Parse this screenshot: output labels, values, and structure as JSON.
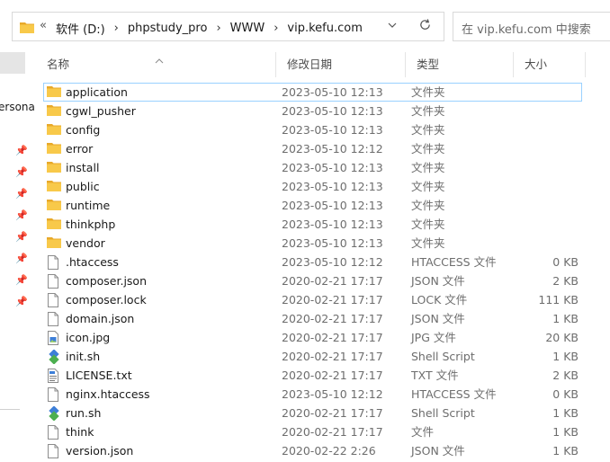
{
  "address": {
    "back_glyph": "«",
    "crumbs": [
      "软件 (D:)",
      "phpstudy_pro",
      "WWW",
      "vip.kefu.com"
    ],
    "separator": "›"
  },
  "search": {
    "placeholder": "在 vip.kefu.com 中搜索"
  },
  "nav": {
    "cut_text": "ersona"
  },
  "columns": {
    "name": "名称",
    "date": "修改日期",
    "type": "类型",
    "size": "大小"
  },
  "files": [
    {
      "name": "application",
      "date": "2023-05-10 12:13",
      "type": "文件夹",
      "size": "",
      "icon": "folder-icon"
    },
    {
      "name": "cgwl_pusher",
      "date": "2023-05-10 12:13",
      "type": "文件夹",
      "size": "",
      "icon": "folder-icon"
    },
    {
      "name": "config",
      "date": "2023-05-10 12:13",
      "type": "文件夹",
      "size": "",
      "icon": "folder-icon"
    },
    {
      "name": "error",
      "date": "2023-05-10 12:12",
      "type": "文件夹",
      "size": "",
      "icon": "folder-icon"
    },
    {
      "name": "install",
      "date": "2023-05-10 12:13",
      "type": "文件夹",
      "size": "",
      "icon": "folder-icon"
    },
    {
      "name": "public",
      "date": "2023-05-10 12:13",
      "type": "文件夹",
      "size": "",
      "icon": "folder-icon"
    },
    {
      "name": "runtime",
      "date": "2023-05-10 12:13",
      "type": "文件夹",
      "size": "",
      "icon": "folder-icon"
    },
    {
      "name": "thinkphp",
      "date": "2023-05-10 12:13",
      "type": "文件夹",
      "size": "",
      "icon": "folder-icon"
    },
    {
      "name": "vendor",
      "date": "2023-05-10 12:13",
      "type": "文件夹",
      "size": "",
      "icon": "folder-icon"
    },
    {
      "name": ".htaccess",
      "date": "2023-05-10 12:12",
      "type": "HTACCESS 文件",
      "size": "0 KB",
      "icon": "file-icon"
    },
    {
      "name": "composer.json",
      "date": "2020-02-21 17:17",
      "type": "JSON 文件",
      "size": "2 KB",
      "icon": "file-icon"
    },
    {
      "name": "composer.lock",
      "date": "2020-02-21 17:17",
      "type": "LOCK 文件",
      "size": "111 KB",
      "icon": "file-icon"
    },
    {
      "name": "domain.json",
      "date": "2020-02-21 17:17",
      "type": "JSON 文件",
      "size": "1 KB",
      "icon": "file-icon"
    },
    {
      "name": "icon.jpg",
      "date": "2020-02-21 17:17",
      "type": "JPG 文件",
      "size": "20 KB",
      "icon": "image-file-icon"
    },
    {
      "name": "init.sh",
      "date": "2020-02-21 17:17",
      "type": "Shell Script",
      "size": "1 KB",
      "icon": "shell-script-icon"
    },
    {
      "name": "LICENSE.txt",
      "date": "2020-02-21 17:17",
      "type": "TXT 文件",
      "size": "2 KB",
      "icon": "text-file-icon"
    },
    {
      "name": "nginx.htaccess",
      "date": "2023-05-10 12:12",
      "type": "HTACCESS 文件",
      "size": "0 KB",
      "icon": "file-icon"
    },
    {
      "name": "run.sh",
      "date": "2020-02-21 17:17",
      "type": "Shell Script",
      "size": "1 KB",
      "icon": "shell-script-icon"
    },
    {
      "name": "think",
      "date": "2020-02-21 17:17",
      "type": "文件",
      "size": "1 KB",
      "icon": "file-icon"
    },
    {
      "name": "version.json",
      "date": "2020-02-22 2:26",
      "type": "JSON 文件",
      "size": "1 KB",
      "icon": "file-icon"
    }
  ],
  "colors": {
    "folder": "#f8c94a",
    "folder_dark": "#e8a92a",
    "selection_border": "#99d1ff",
    "shell_blue": "#3d7fd8",
    "shell_green": "#4caf50"
  }
}
